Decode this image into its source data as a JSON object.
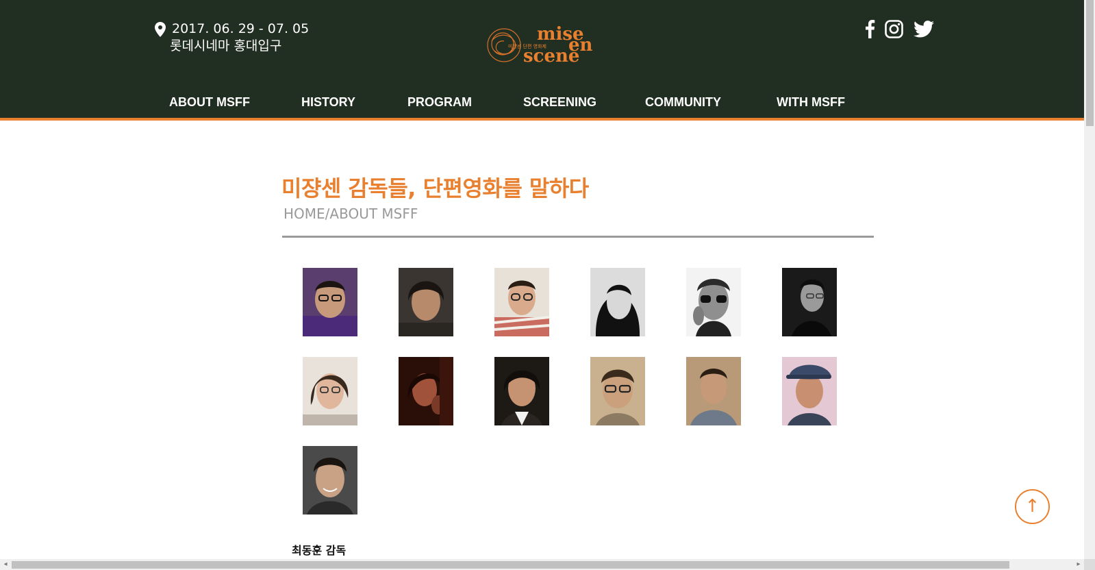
{
  "header": {
    "date": "2017. 06. 29 - 07. 05",
    "venue": "롯데시네마 홍대입구",
    "logo_text": [
      "mise",
      "en",
      "scene"
    ],
    "logo_subtitle": "미쟝센 단편 영화제",
    "brand_color": "#e8802f",
    "background_color": "#212e22"
  },
  "social": {
    "icons": [
      "facebook-icon",
      "instagram-icon",
      "twitter-icon"
    ]
  },
  "nav": {
    "items": [
      "ABOUT MSFF",
      "HISTORY",
      "PROGRAM",
      "SCREENING",
      "COMMUNITY",
      "WITH MSFF"
    ]
  },
  "page": {
    "title": "미쟝센 감독들, 단편영화를 말하다",
    "breadcrumb": "HOME/ABOUT MSFF"
  },
  "directors": {
    "photo_count": 13,
    "selected_name": "최동훈 감독"
  },
  "controls": {
    "top_button": "↑"
  }
}
